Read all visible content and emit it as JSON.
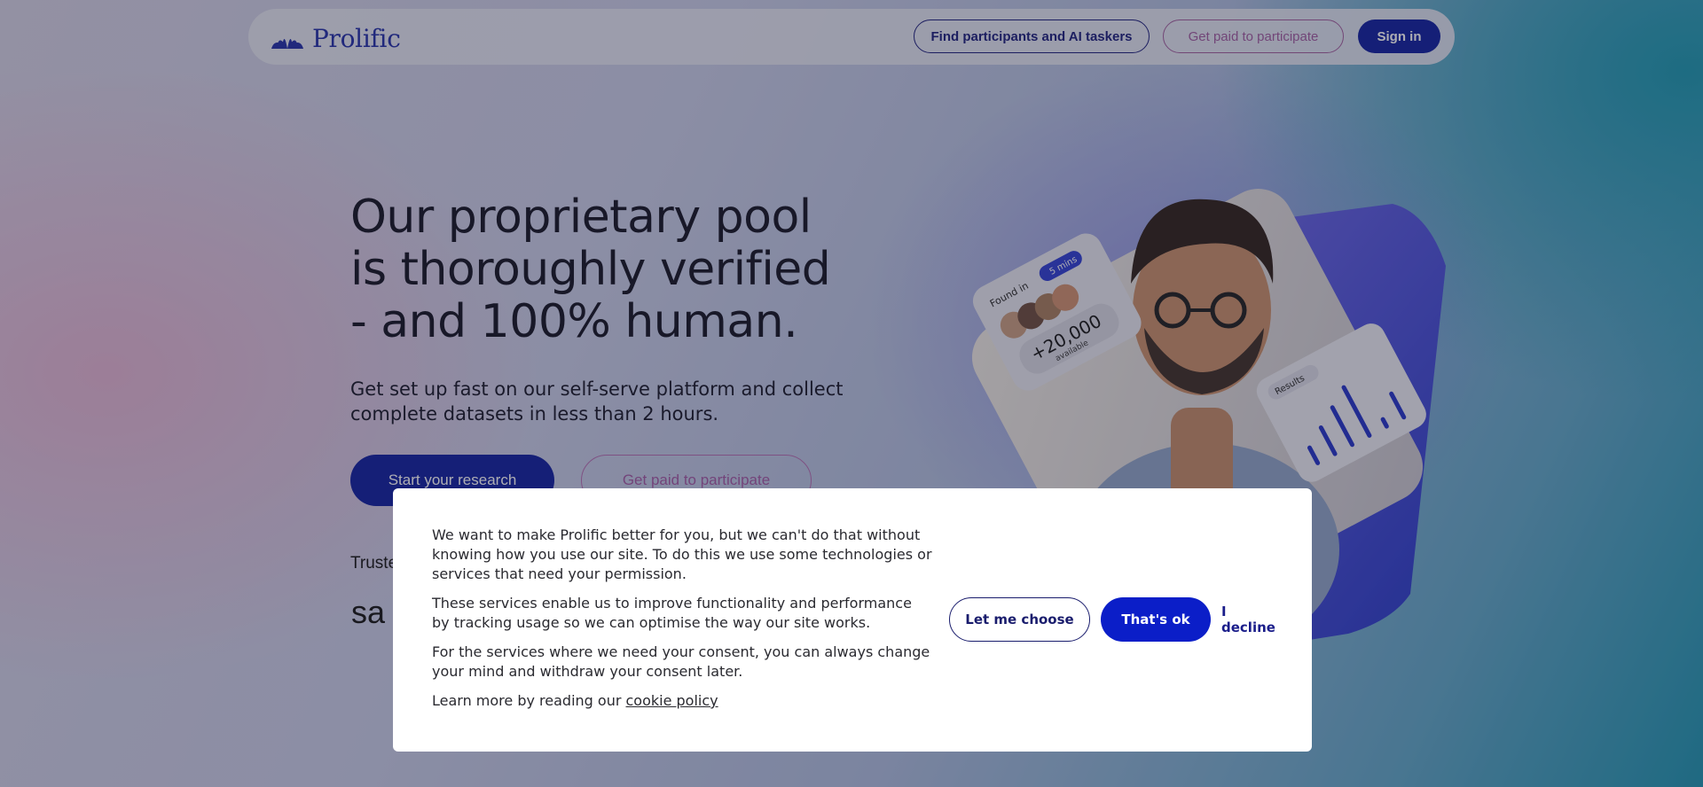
{
  "header": {
    "logo_text": "Prolific",
    "find_label": "Find participants and AI taskers",
    "paid_label": "Get paid to participate",
    "sign_in_label": "Sign in"
  },
  "hero": {
    "title_lines": [
      "Our proprietary pool",
      "is thoroughly verified",
      "- and 100% human."
    ],
    "subtitle": "Get set up fast on our self-serve platform and collect complete datasets in less than 2 hours.",
    "start_label": "Start your research",
    "paid_label": "Get paid to participate",
    "trusted_text": "Truste",
    "brand_text": "sa"
  },
  "illustration": {
    "found_label": "Found in",
    "time_badge": "5 mins",
    "count": "+20,000",
    "count_sub": "available",
    "results_label": "Results",
    "bar_levels": [
      0.35,
      0.55,
      0.75,
      0.95,
      0.2,
      0.5
    ]
  },
  "cookie": {
    "p1": "We want to make Prolific better for you, but we can't do that without knowing how you use our site. To do this we use some technologies or services that need your permission.",
    "p2": "These services enable us to improve functionality and performance by tracking usage so we can optimise the way our site works.",
    "p3": "For the services where we need your consent, you can always change your mind and withdraw your consent later.",
    "p4_prefix": "Learn more by reading our ",
    "policy_link": "cookie policy",
    "choose_label": "Let me choose",
    "ok_label": "That's ok",
    "decline_label": "I decline"
  },
  "colors": {
    "brand_blue": "#0b1a9e",
    "accent_pink": "#a256a3",
    "cookie_ok_blue": "#0b1ec8"
  }
}
